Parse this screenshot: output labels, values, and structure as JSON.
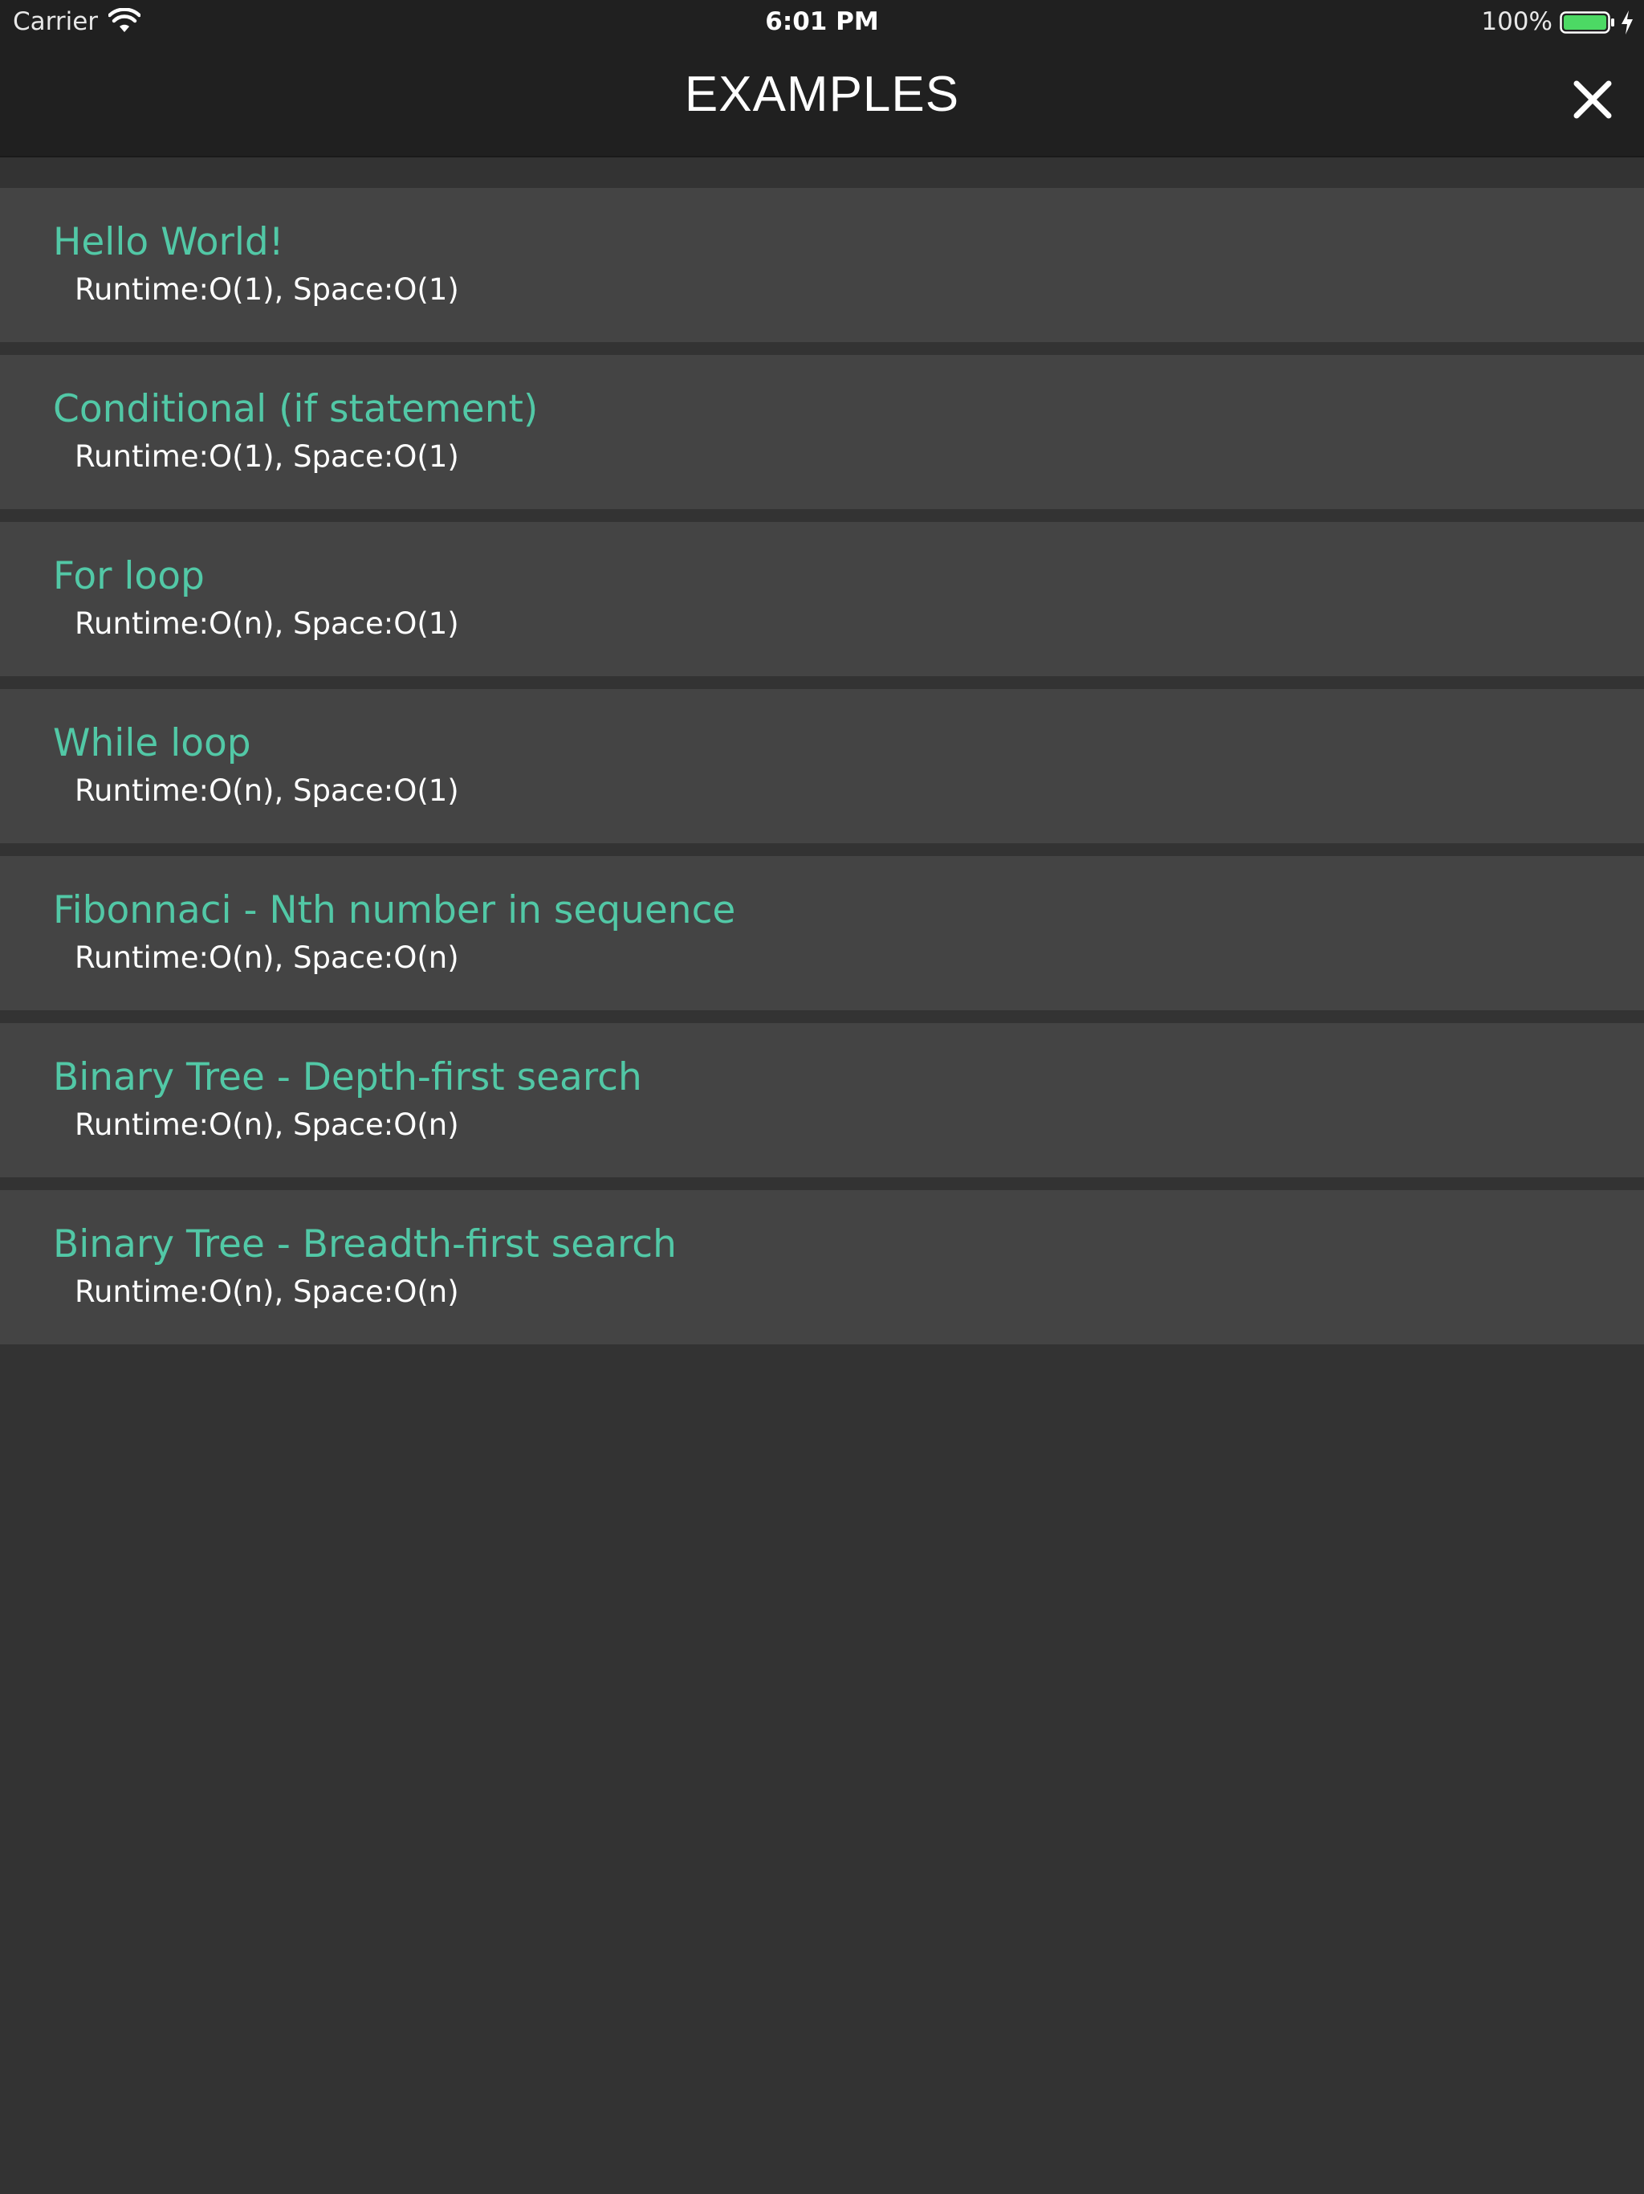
{
  "status_bar": {
    "carrier": "Carrier",
    "time": "6:01 PM",
    "battery_percent": "100%",
    "battery_level": 1.0,
    "battery_color": "#4cd964",
    "icons": [
      "wifi-icon",
      "battery-icon",
      "charging-bolt-icon"
    ]
  },
  "nav": {
    "title": "EXAMPLES",
    "close_icon": "close-icon"
  },
  "colors": {
    "background": "#333333",
    "row_background": "#444444",
    "title_accent": "#52c8a6",
    "bar_background": "#202020"
  },
  "examples": [
    {
      "title": "Hello World!",
      "complexity": "Runtime:O(1), Space:O(1)"
    },
    {
      "title": "Conditional (if statement)",
      "complexity": "Runtime:O(1), Space:O(1)"
    },
    {
      "title": "For loop",
      "complexity": "Runtime:O(n), Space:O(1)"
    },
    {
      "title": "While loop",
      "complexity": "Runtime:O(n), Space:O(1)"
    },
    {
      "title": "Fibonnaci - Nth number in sequence",
      "complexity": "Runtime:O(n), Space:O(n)"
    },
    {
      "title": "Binary Tree - Depth-first search",
      "complexity": "Runtime:O(n), Space:O(n)"
    },
    {
      "title": "Binary Tree - Breadth-first search",
      "complexity": "Runtime:O(n), Space:O(n)"
    }
  ]
}
